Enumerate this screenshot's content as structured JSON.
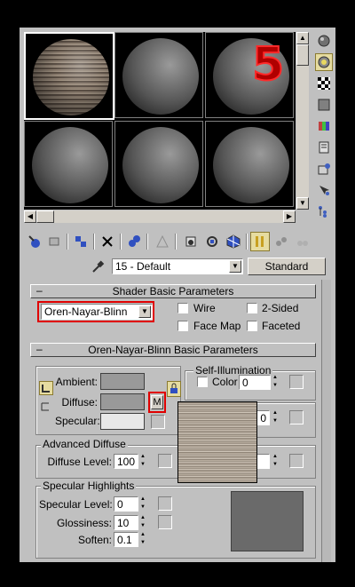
{
  "overlay_number": "5",
  "toolbar": {
    "material_name": "15 - Default",
    "material_type": "Standard"
  },
  "shader_basic": {
    "title": "Shader Basic Parameters",
    "shader_value": "Oren-Nayar-Blinn",
    "wire": "Wire",
    "two_sided": "2-Sided",
    "face_map": "Face Map",
    "faceted": "Faceted"
  },
  "onb_basic": {
    "title": "Oren-Nayar-Blinn Basic Parameters",
    "self_illum_title": "Self-Illumination",
    "color_label": "Color",
    "color_value": "0",
    "ambient": "Ambient:",
    "diffuse": "Diffuse:",
    "specular": "Specular:",
    "map_button": "M",
    "lock_icon": "lock-icon",
    "hidden_value": "0",
    "advanced_diffuse_title": "Advanced Diffuse",
    "diffuse_level_label": "Diffuse Level:",
    "diffuse_level_value": "100",
    "spec_title": "Specular Highlights",
    "spec_level_label": "Specular Level:",
    "spec_level_value": "0",
    "glossiness_label": "Glossiness:",
    "glossiness_value": "10",
    "soften_label": "Soften:",
    "soften_value": "0.1"
  },
  "colors": {
    "highlight_red": "#e00000",
    "panel_gray": "#c0c0c0",
    "swatch_gray": "#999999"
  }
}
